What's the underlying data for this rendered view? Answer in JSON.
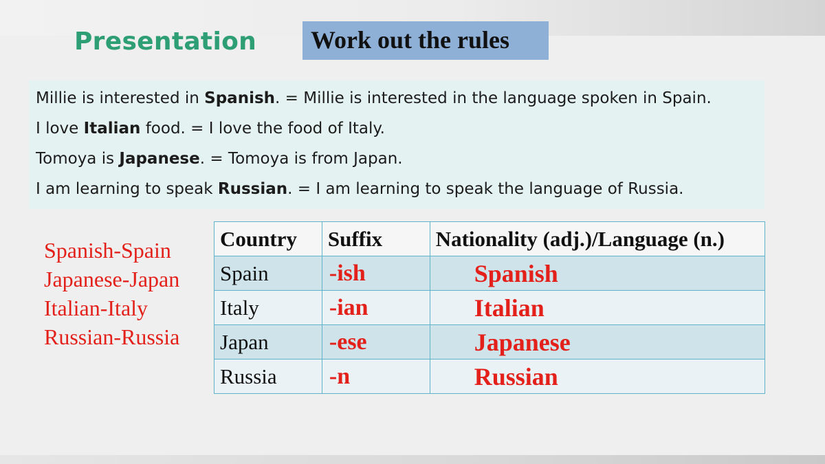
{
  "slide": {
    "title": "Presentation",
    "rules_heading": "Work out the rules"
  },
  "examples": [
    {
      "pre": "Millie is interested in ",
      "bold": "Spanish",
      "post": ". = Millie is interested in the language spoken in Spain."
    },
    {
      "pre": "I love ",
      "bold": "Italian",
      "post": " food. = I love the food of Italy."
    },
    {
      "pre": "Tomoya is ",
      "bold": "Japanese",
      "post": ". = Tomoya is from Japan."
    },
    {
      "pre": "I am learning to speak ",
      "bold": "Russian",
      "post": ". = I am learning to speak the language of Russia."
    }
  ],
  "pairs": [
    "Spanish-Spain",
    "Japanese-Japan",
    "Italian-Italy",
    "Russian-Russia"
  ],
  "table": {
    "headers": [
      "Country",
      "Suffix",
      "Nationality (adj.)/Language (n.)"
    ],
    "rows": [
      {
        "country": "Spain",
        "suffix": "-ish",
        "nationality": "Spanish"
      },
      {
        "country": "Italy",
        "suffix": "-ian",
        "nationality": "Italian"
      },
      {
        "country": "Japan",
        "suffix": "-ese",
        "nationality": "Japanese"
      },
      {
        "country": "Russia",
        "suffix": "-n",
        "nationality": "Russian"
      }
    ]
  },
  "colors": {
    "title_green": "#2e9e74",
    "answer_red": "#e3201a",
    "heading_box_blue": "#8fb0d6",
    "example_panel": "#e4f3f1"
  }
}
